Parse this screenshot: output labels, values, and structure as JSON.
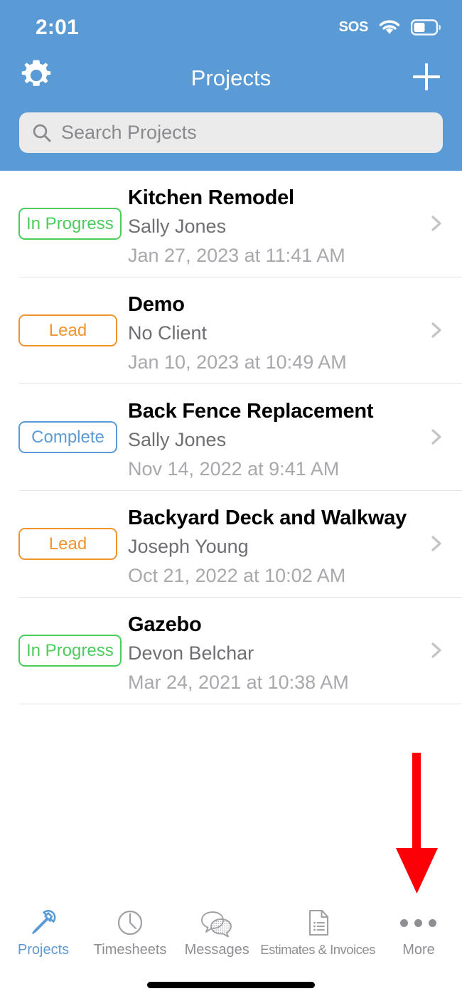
{
  "status_bar": {
    "time": "2:01",
    "sos_label": "SOS",
    "wifi_icon": "wifi-icon",
    "battery_icon": "battery-icon"
  },
  "nav": {
    "title": "Projects",
    "settings_icon": "gear-icon",
    "add_icon": "plus-icon"
  },
  "search": {
    "placeholder": "Search Projects",
    "value": "",
    "icon": "search-icon"
  },
  "colors": {
    "header_blue": "#5b9bd5",
    "accent_blue": "#5b9bd5",
    "status_green": "#4ccc5b",
    "status_orange": "#f0942e",
    "status_blue": "#5b9bd5",
    "search_bg": "#ebebeb",
    "annotation_red": "#fb0007"
  },
  "projects": [
    {
      "status": "In Progress",
      "status_color": "green",
      "title": "Kitchen Remodel",
      "client": "Sally Jones",
      "date": "Jan 27, 2023 at 11:41 AM"
    },
    {
      "status": "Lead",
      "status_color": "orange",
      "title": "Demo",
      "client": "No Client",
      "date": "Jan 10, 2023 at 10:49 AM"
    },
    {
      "status": "Complete",
      "status_color": "blue",
      "title": "Back Fence Replacement",
      "client": "Sally Jones",
      "date": "Nov 14, 2022 at 9:41 AM"
    },
    {
      "status": "Lead",
      "status_color": "orange",
      "title": "Backyard Deck and Walkway",
      "client": "Joseph Young",
      "date": "Oct 21, 2022 at 10:02 AM"
    },
    {
      "status": "In Progress",
      "status_color": "green",
      "title": "Gazebo",
      "client": "Devon Belchar",
      "date": "Mar 24, 2021 at 10:38 AM"
    }
  ],
  "tabs": [
    {
      "label": "Projects",
      "icon": "hammer-icon",
      "active": true
    },
    {
      "label": "Timesheets",
      "icon": "clock-icon",
      "active": false
    },
    {
      "label": "Messages",
      "icon": "chat-bubbles-icon",
      "active": false
    },
    {
      "label": "Estimates & Invoices",
      "icon": "document-list-icon",
      "active": false
    },
    {
      "label": "More",
      "icon": "ellipsis-icon",
      "active": false
    }
  ],
  "annotation": {
    "type": "down-arrow",
    "points_at": "More"
  }
}
